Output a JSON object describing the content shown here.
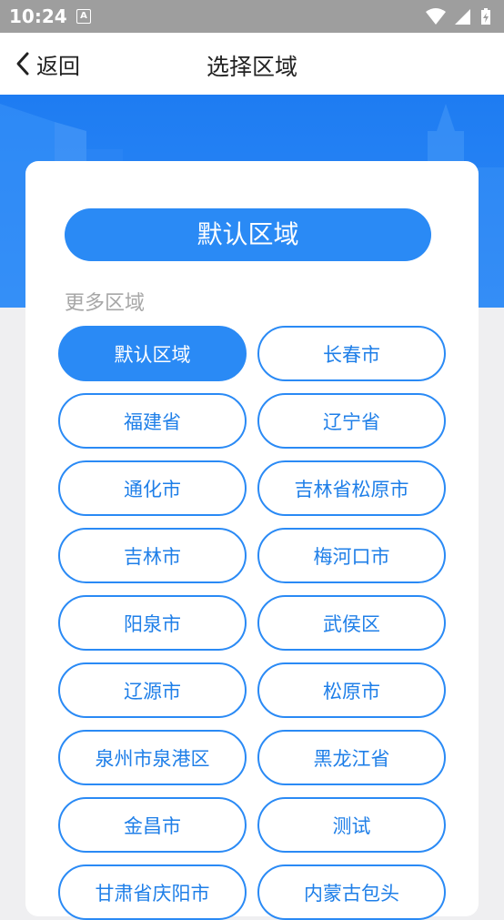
{
  "status_bar": {
    "time": "10:24",
    "notification_letter": "A"
  },
  "nav": {
    "back_label": "返回",
    "title": "选择区域"
  },
  "default_button": {
    "label": "默认区域"
  },
  "more_label": "更多区域",
  "regions": [
    {
      "label": "默认区域",
      "selected": true
    },
    {
      "label": "长春市",
      "selected": false
    },
    {
      "label": "福建省",
      "selected": false
    },
    {
      "label": "辽宁省",
      "selected": false
    },
    {
      "label": "通化市",
      "selected": false
    },
    {
      "label": "吉林省松原市",
      "selected": false
    },
    {
      "label": "吉林市",
      "selected": false
    },
    {
      "label": "梅河口市",
      "selected": false
    },
    {
      "label": "阳泉市",
      "selected": false
    },
    {
      "label": "武侯区",
      "selected": false
    },
    {
      "label": "辽源市",
      "selected": false
    },
    {
      "label": "松原市",
      "selected": false
    },
    {
      "label": "泉州市泉港区",
      "selected": false
    },
    {
      "label": "黑龙江省",
      "selected": false
    },
    {
      "label": "金昌市",
      "selected": false
    },
    {
      "label": "测试",
      "selected": false
    },
    {
      "label": "甘肃省庆阳市",
      "selected": false
    },
    {
      "label": "内蒙古包头",
      "selected": false
    }
  ],
  "colors": {
    "accent": "#2a8af5",
    "hero": "#1e7cf2",
    "background": "#efeff1"
  }
}
